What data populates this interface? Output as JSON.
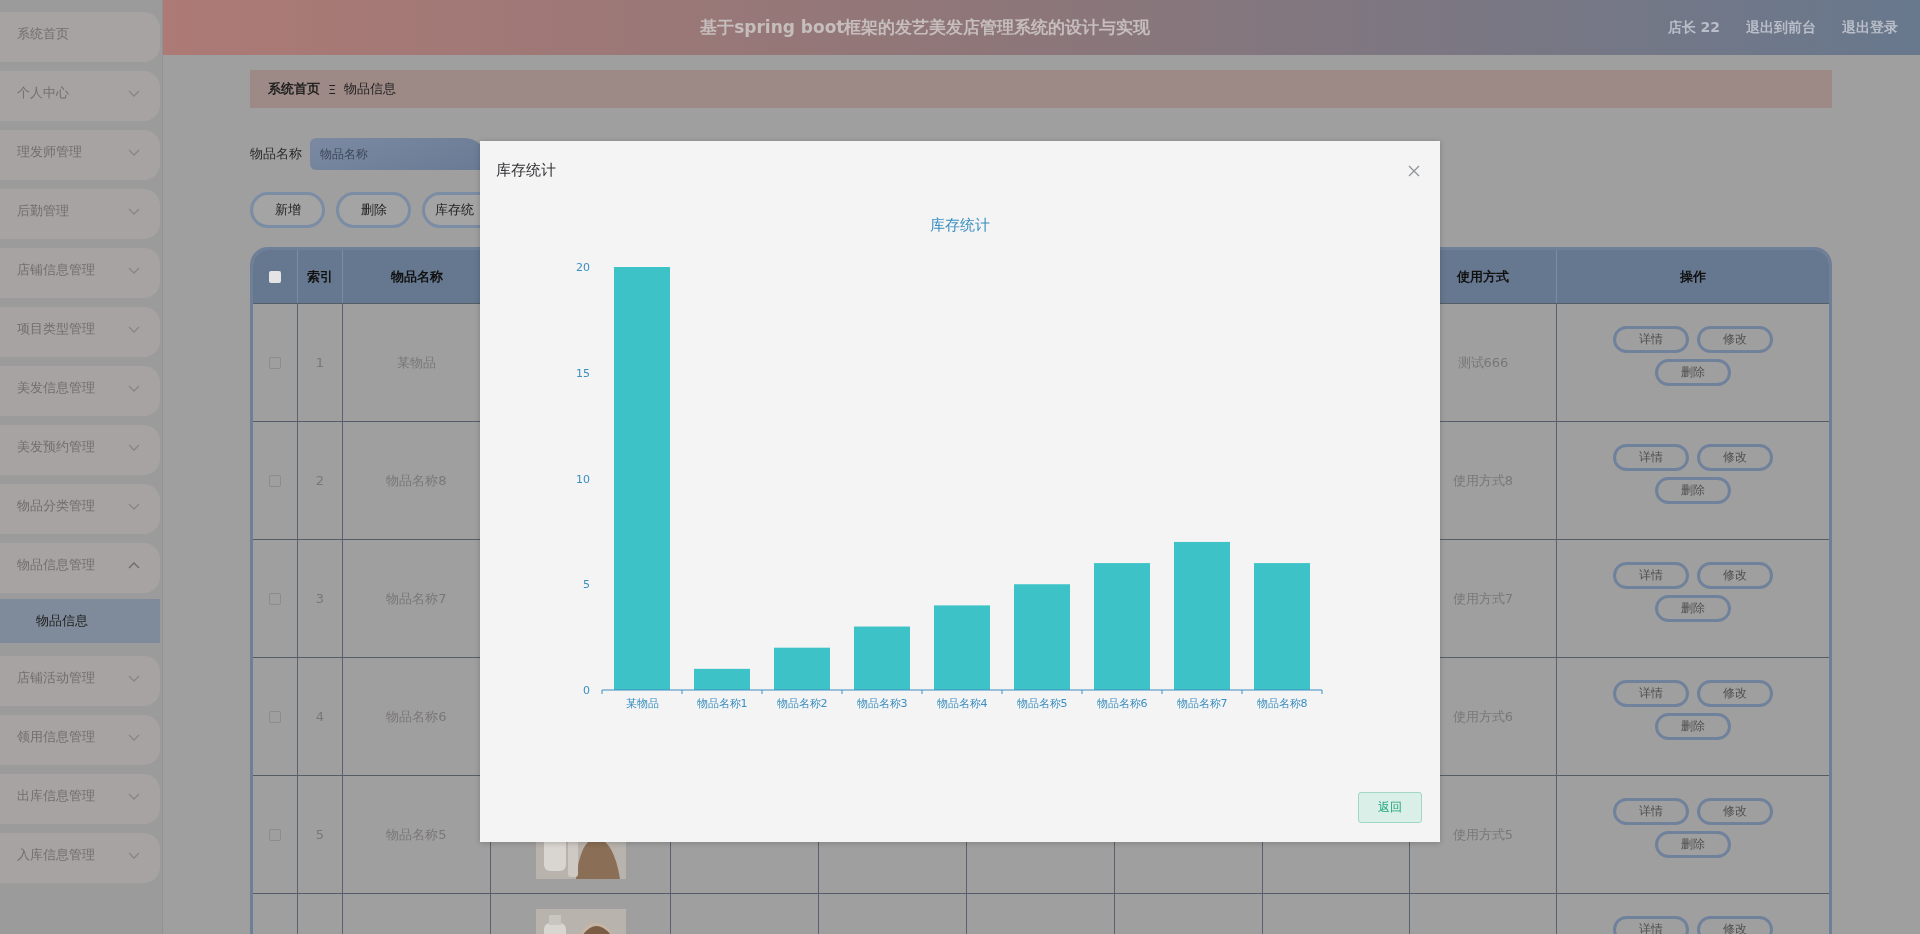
{
  "sidebar": {
    "items": [
      {
        "label": "系统首页",
        "kind": "link"
      },
      {
        "label": "个人中心",
        "kind": "menu",
        "expanded": false
      },
      {
        "label": "理发师管理",
        "kind": "menu",
        "expanded": false
      },
      {
        "label": "后勤管理",
        "kind": "menu",
        "expanded": false
      },
      {
        "label": "店铺信息管理",
        "kind": "menu",
        "expanded": false
      },
      {
        "label": "项目类型管理",
        "kind": "menu",
        "expanded": false
      },
      {
        "label": "美发信息管理",
        "kind": "menu",
        "expanded": false
      },
      {
        "label": "美发预约管理",
        "kind": "menu",
        "expanded": false
      },
      {
        "label": "物品分类管理",
        "kind": "menu",
        "expanded": false
      },
      {
        "label": "物品信息管理",
        "kind": "menu",
        "expanded": true,
        "children": [
          {
            "label": "物品信息",
            "selected": true
          }
        ]
      },
      {
        "label": "店铺活动管理",
        "kind": "menu",
        "expanded": false
      },
      {
        "label": "领用信息管理",
        "kind": "menu",
        "expanded": false
      },
      {
        "label": "出库信息管理",
        "kind": "menu",
        "expanded": false
      },
      {
        "label": "入库信息管理",
        "kind": "menu",
        "expanded": false
      }
    ]
  },
  "header": {
    "title": "基于spring boot框架的发艺美发店管理系统的设计与实现",
    "user": "店长 22",
    "links": [
      "退出到前台",
      "退出登录"
    ]
  },
  "breadcrumb": {
    "items": [
      "系统首页",
      "物品信息"
    ],
    "separator": "Ξ"
  },
  "search": {
    "label": "物品名称",
    "placeholder": "物品名称"
  },
  "actions": [
    "新增",
    "删除",
    "库存统"
  ],
  "table": {
    "select_all": {
      "checked": false
    },
    "columns": [
      "索引",
      "物品名称",
      "使用方式",
      "操作"
    ],
    "rows": [
      {
        "checked": false,
        "index": "1",
        "name": "某物品",
        "usage": "测试666",
        "actions": [
          "详情",
          "修改",
          "删除"
        ]
      },
      {
        "checked": false,
        "index": "2",
        "name": "物品名称8",
        "usage": "使用方式8",
        "actions": [
          "详情",
          "修改",
          "删除"
        ]
      },
      {
        "checked": false,
        "index": "3",
        "name": "物品名称7",
        "usage": "使用方式7",
        "actions": [
          "详情",
          "修改",
          "删除"
        ]
      },
      {
        "checked": false,
        "index": "4",
        "name": "物品名称6",
        "usage": "使用方式6",
        "actions": [
          "详情",
          "修改",
          "删除"
        ]
      },
      {
        "checked": false,
        "index": "5",
        "name": "物品名称5",
        "usage": "使用方式5",
        "image": {
          "kind": "picture"
        },
        "actions": [
          "详情",
          "修改",
          "删除"
        ]
      },
      {
        "image": {
          "kind": "picture"
        },
        "actions": [
          "详情",
          "修改"
        ]
      }
    ]
  },
  "dialog": {
    "title": "库存统计",
    "button": "返回",
    "chart_data": {
      "type": "bar",
      "title": "库存统计",
      "categories": [
        "某物品",
        "物品名称1",
        "物品名称2",
        "物品名称3",
        "物品名称4",
        "物品名称5",
        "物品名称6",
        "物品名称7",
        "物品名称8"
      ],
      "series": [
        {
          "color": "#3cc2c7",
          "values": [
            20,
            1,
            2,
            3,
            4,
            5,
            6,
            7,
            6
          ]
        }
      ],
      "ylim": [
        0,
        20
      ],
      "yticks": [
        0,
        5,
        10,
        15,
        20
      ]
    }
  }
}
